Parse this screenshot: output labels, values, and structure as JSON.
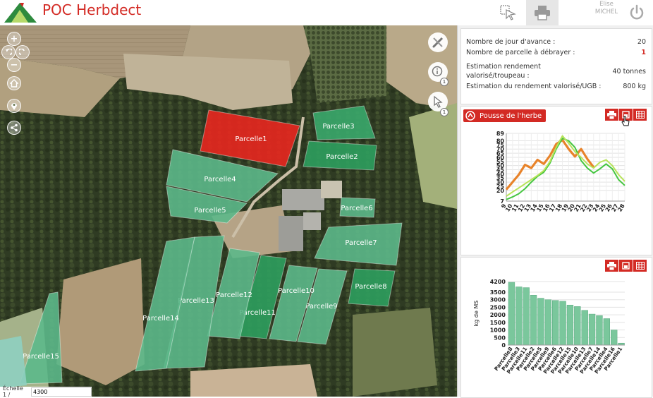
{
  "header": {
    "title": "POC Herbdect",
    "user_first": "Elise",
    "user_last": "MICHEL"
  },
  "map": {
    "zoom_in": "+",
    "zoom_out": "−",
    "tool_badges": [
      "1",
      "1"
    ],
    "scale_label": "Échelle 1 /",
    "scale_value": "4300",
    "parcels": [
      {
        "label": "Parcelle1",
        "color": "#e8271f"
      },
      {
        "label": "Parcelle2",
        "color": "#2d9e5e"
      },
      {
        "label": "Parcelle3",
        "color": "#3aa86c"
      },
      {
        "label": "Parcelle4",
        "color": "#5cb88a"
      },
      {
        "label": "Parcelle5",
        "color": "#5cb88a"
      },
      {
        "label": "Parcelle6",
        "color": "#5cb88a"
      },
      {
        "label": "Parcelle7",
        "color": "#5cb88a"
      },
      {
        "label": "Parcelle8",
        "color": "#2d9e5e"
      },
      {
        "label": "Parcelle9",
        "color": "#5cb88a"
      },
      {
        "label": "Parcelle10",
        "color": "#5cb88a"
      },
      {
        "label": "Parcelle11",
        "color": "#2d9e5e"
      },
      {
        "label": "Parcelle12",
        "color": "#5cb88a"
      },
      {
        "label": "Parcelle13",
        "color": "#5cb88a"
      },
      {
        "label": "Parcelle14",
        "color": "#5cb88a"
      },
      {
        "label": "Parcelle15",
        "color": "#5cb88a"
      }
    ]
  },
  "stats": {
    "rows": [
      {
        "label": "Nombre de jour d'avance :",
        "value": "20"
      },
      {
        "label": "Nombre de parcelle à débrayer :",
        "value": "1"
      },
      {
        "label": "Estimation rendement\nvalorisé/troupeau :",
        "value": "40 tonnes"
      },
      {
        "label": "Estimation du rendement valorisé/UGB :",
        "value": "800 kg"
      }
    ],
    "alert_color": "#d32a24"
  },
  "pousse_button": "Pousse de l'herbe",
  "colors": {
    "accent": "#d32a24",
    "line_orange": "#e8832a",
    "line_green": "#45c640",
    "line_lightgreen": "#b8e35a",
    "bar_green": "#7ac79c"
  },
  "chart_data": [
    {
      "type": "line",
      "x": [
        9,
        10,
        11,
        12,
        13,
        14,
        15,
        16,
        17,
        18,
        19,
        20,
        21,
        22,
        23,
        24,
        25,
        26,
        27,
        28
      ],
      "x_labels": [
        "9",
        "10",
        "11",
        "12",
        "13",
        "14",
        "15",
        "16",
        "17",
        "18",
        "19",
        "20",
        "21",
        "22",
        "23",
        "24",
        "25",
        "26",
        "27",
        "28"
      ],
      "y_ticks": [
        7,
        20,
        25,
        30,
        35,
        40,
        45,
        50,
        55,
        60,
        65,
        70,
        75,
        80,
        89
      ],
      "ylim": [
        7,
        89
      ],
      "series": [
        {
          "color": "#e8832a",
          "values": [
            21,
            30,
            39,
            51,
            47,
            57,
            52,
            62,
            76,
            81,
            70,
            61,
            70,
            58,
            48,
            null,
            null,
            null,
            null,
            null
          ]
        },
        {
          "color": "#45c640",
          "values": [
            9,
            12,
            16,
            22,
            30,
            37,
            42,
            53,
            70,
            83,
            80,
            72,
            56,
            47,
            41,
            46,
            52,
            46,
            33,
            26
          ]
        },
        {
          "color": "#b8e35a",
          "values": [
            13,
            18,
            23,
            28,
            33,
            38,
            44,
            55,
            72,
            86,
            77,
            67,
            60,
            52,
            47,
            54,
            57,
            50,
            39,
            31
          ]
        }
      ],
      "legend": "none",
      "grid": true
    },
    {
      "type": "bar",
      "categories": [
        "Parcelle8",
        "Parcelle3",
        "Parcelle11",
        "Parcelle2",
        "Parcelle5",
        "Parcelle9",
        "Parcelle6",
        "Parcelle12",
        "Parcelle15",
        "Parcelle10",
        "Parcelle13",
        "Parcelle7",
        "Parcelle14",
        "Parcelle4",
        "Parcelle16",
        "Parcelle1"
      ],
      "values": [
        4150,
        3850,
        3800,
        3300,
        3100,
        3000,
        2950,
        2900,
        2650,
        2550,
        2300,
        2050,
        1950,
        1750,
        1000,
        130
      ],
      "ylabel": "kg de MS",
      "y_ticks": [
        0,
        500,
        1000,
        1500,
        2000,
        2500,
        3000,
        3500,
        4200
      ],
      "ylim": [
        0,
        4200
      ],
      "grid": true
    }
  ]
}
